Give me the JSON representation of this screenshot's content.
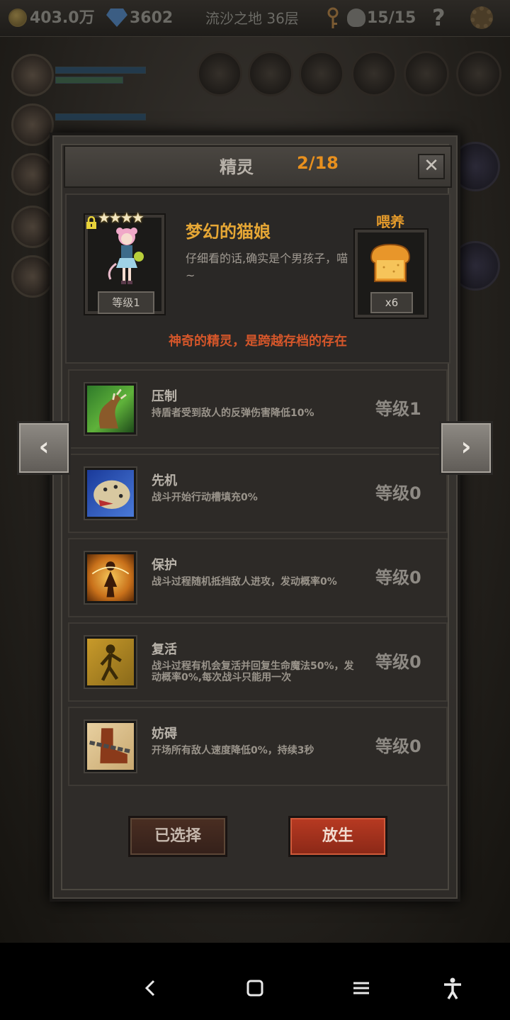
{
  "topbar": {
    "gold": "403.0万",
    "gems": "3602",
    "location": "流沙之地 36层",
    "skull_count": "15/15",
    "help_label": "?"
  },
  "dialog": {
    "title": "精灵",
    "count": "2/18",
    "close_label": "✕",
    "spirit": {
      "stars": "★★★★",
      "level": "等级1",
      "name": "梦幻的猫娘",
      "description": "仔细看的话,确实是个男孩子，喵~",
      "feed_label": "喂养",
      "feed_count": "x6",
      "tagline": "神奇的精灵，是跨越存档的存在"
    },
    "skills": [
      {
        "name": "压制",
        "desc": "持盾者受到敌人的反弹伤害降低10%",
        "level": "等级1",
        "icon": "claw-icon"
      },
      {
        "name": "先机",
        "desc": "战斗开始行动槽填充0%",
        "level": "等级0",
        "icon": "leopard-icon"
      },
      {
        "name": "保护",
        "desc": "战斗过程随机抵挡敌人进攻，发动概率0%",
        "level": "等级0",
        "icon": "guardian-icon"
      },
      {
        "name": "复活",
        "desc": "战斗过程有机会复活并回复生命魔法50%，发动概率0%,每次战斗只能用一次",
        "level": "等级0",
        "icon": "revive-icon"
      },
      {
        "name": "妨碍",
        "desc": "开场所有敌人速度降低0%，持续3秒",
        "level": "等级0",
        "icon": "chained-boot-icon"
      }
    ],
    "buttons": {
      "selected": "已选择",
      "release": "放生"
    }
  },
  "nav": {
    "prev": "‹",
    "next": "›"
  },
  "colors": {
    "accent_orange": "#e8901e",
    "name_gold": "#e6a735",
    "tagline_red": "#d4562a",
    "release_red": "#b83a22"
  }
}
